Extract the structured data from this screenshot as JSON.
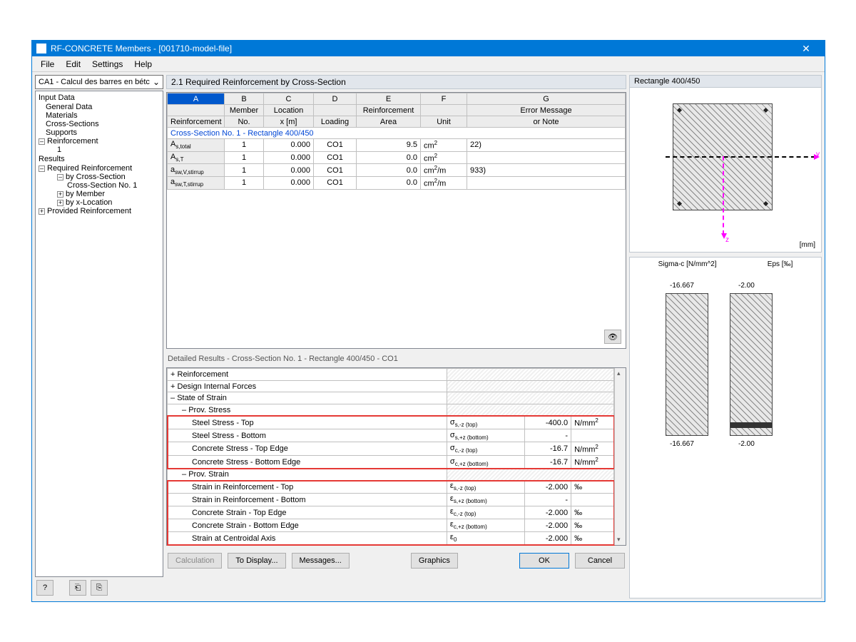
{
  "window": {
    "title": "RF-CONCRETE Members - [001710-model-file]"
  },
  "menubar": [
    "File",
    "Edit",
    "Settings",
    "Help"
  ],
  "left": {
    "dropdown": "CA1 - Calcul des barres en bétc",
    "tree": {
      "input_title": "Input Data",
      "input_items": [
        "General Data",
        "Materials",
        "Cross-Sections",
        "Supports"
      ],
      "reinf": "Reinforcement",
      "reinf_sub": "1",
      "results_title": "Results",
      "req_reinf": "Required Reinforcement",
      "by_cs": "by Cross-Section",
      "cs_no1": "Cross-Section No. 1",
      "by_member": "by Member",
      "by_xloc": "by x-Location",
      "prov_reinf": "Provided Reinforcement"
    }
  },
  "main": {
    "title": "2.1 Required Reinforcement by Cross-Section",
    "cols_letters": [
      "A",
      "B",
      "C",
      "D",
      "E",
      "F",
      "G"
    ],
    "cols_h1": [
      "",
      "Member",
      "Location",
      "",
      "Reinforcement",
      "",
      "Error Message"
    ],
    "cols_h2": [
      "Reinforcement",
      "No.",
      "x [m]",
      "Loading",
      "Area",
      "Unit",
      "or Note"
    ],
    "section_row": "Cross-Section No. 1 - Rectangle 400/450",
    "rows": [
      {
        "label": "A<sub>s,total</sub>",
        "member": "1",
        "x": "0.000",
        "loading": "CO1",
        "area": "9.5",
        "unit": "cm<sup>2</sup>",
        "note": "22)"
      },
      {
        "label": "A<sub>s,T</sub>",
        "member": "1",
        "x": "0.000",
        "loading": "CO1",
        "area": "0.0",
        "unit": "cm<sup>2</sup>",
        "note": ""
      },
      {
        "label": "a<sub>sw,V,stirrup</sub>",
        "member": "1",
        "x": "0.000",
        "loading": "CO1",
        "area": "0.0",
        "unit": "cm<sup>2</sup>/m",
        "note": "933)"
      },
      {
        "label": "a<sub>sw,T,stirrup</sub>",
        "member": "1",
        "x": "0.000",
        "loading": "CO1",
        "area": "0.0",
        "unit": "cm<sup>2</sup>/m",
        "note": ""
      }
    ],
    "detail_title": "Detailed Results  -  Cross-Section No. 1 - Rectangle 400/450  -  CO1",
    "detail_groups": {
      "reinforcement": "Reinforcement",
      "design_forces": "Design Internal Forces",
      "state_strain": "State of Strain",
      "prov_stress": "Prov. Stress",
      "prov_strain": "Prov. Strain"
    },
    "stress_rows": [
      {
        "label": "Steel Stress - Top",
        "sym": "σ<sub>s,-z (top)</sub>",
        "val": "-400.0",
        "unit": "N/mm<sup>2</sup>"
      },
      {
        "label": "Steel Stress - Bottom",
        "sym": "σ<sub>s,+z (bottom)</sub>",
        "val": "-",
        "unit": ""
      },
      {
        "label": "Concrete Stress - Top Edge",
        "sym": "σ<sub>c,-z (top)</sub>",
        "val": "-16.7",
        "unit": "N/mm<sup>2</sup>"
      },
      {
        "label": "Concrete Stress - Bottom Edge",
        "sym": "σ<sub>c,+z (bottom)</sub>",
        "val": "-16.7",
        "unit": "N/mm<sup>2</sup>"
      }
    ],
    "strain_rows": [
      {
        "label": "Strain in Reinforcement - Top",
        "sym": "ε<sub>s,-z (top)</sub>",
        "val": "-2.000",
        "unit": "‰"
      },
      {
        "label": "Strain in Reinforcement - Bottom",
        "sym": "ε<sub>s,+z (bottom)</sub>",
        "val": "-",
        "unit": ""
      },
      {
        "label": "Concrete Strain - Top Edge",
        "sym": "ε<sub>c,-z (top)</sub>",
        "val": "-2.000",
        "unit": "‰"
      },
      {
        "label": "Concrete Strain - Bottom Edge",
        "sym": "ε<sub>c,+z (bottom)</sub>",
        "val": "-2.000",
        "unit": "‰"
      },
      {
        "label": "Strain at Centroidal Axis",
        "sym": "ε<sub>0</sub>",
        "val": "-2.000",
        "unit": "‰"
      }
    ],
    "buttons": {
      "calculation": "Calculation",
      "to_display": "To Display...",
      "messages": "Messages...",
      "graphics": "Graphics",
      "ok": "OK",
      "cancel": "Cancel"
    }
  },
  "right": {
    "section_title": "Rectangle 400/450",
    "y": "y",
    "z": "z",
    "mm": "[mm]",
    "chart_h1": "Sigma-c [N/mm^2]",
    "chart_h2": "Eps [‰]",
    "sigma_top": "-16.667",
    "sigma_bot": "-16.667",
    "eps_top": "-2.00",
    "eps_bot": "-2.00"
  }
}
